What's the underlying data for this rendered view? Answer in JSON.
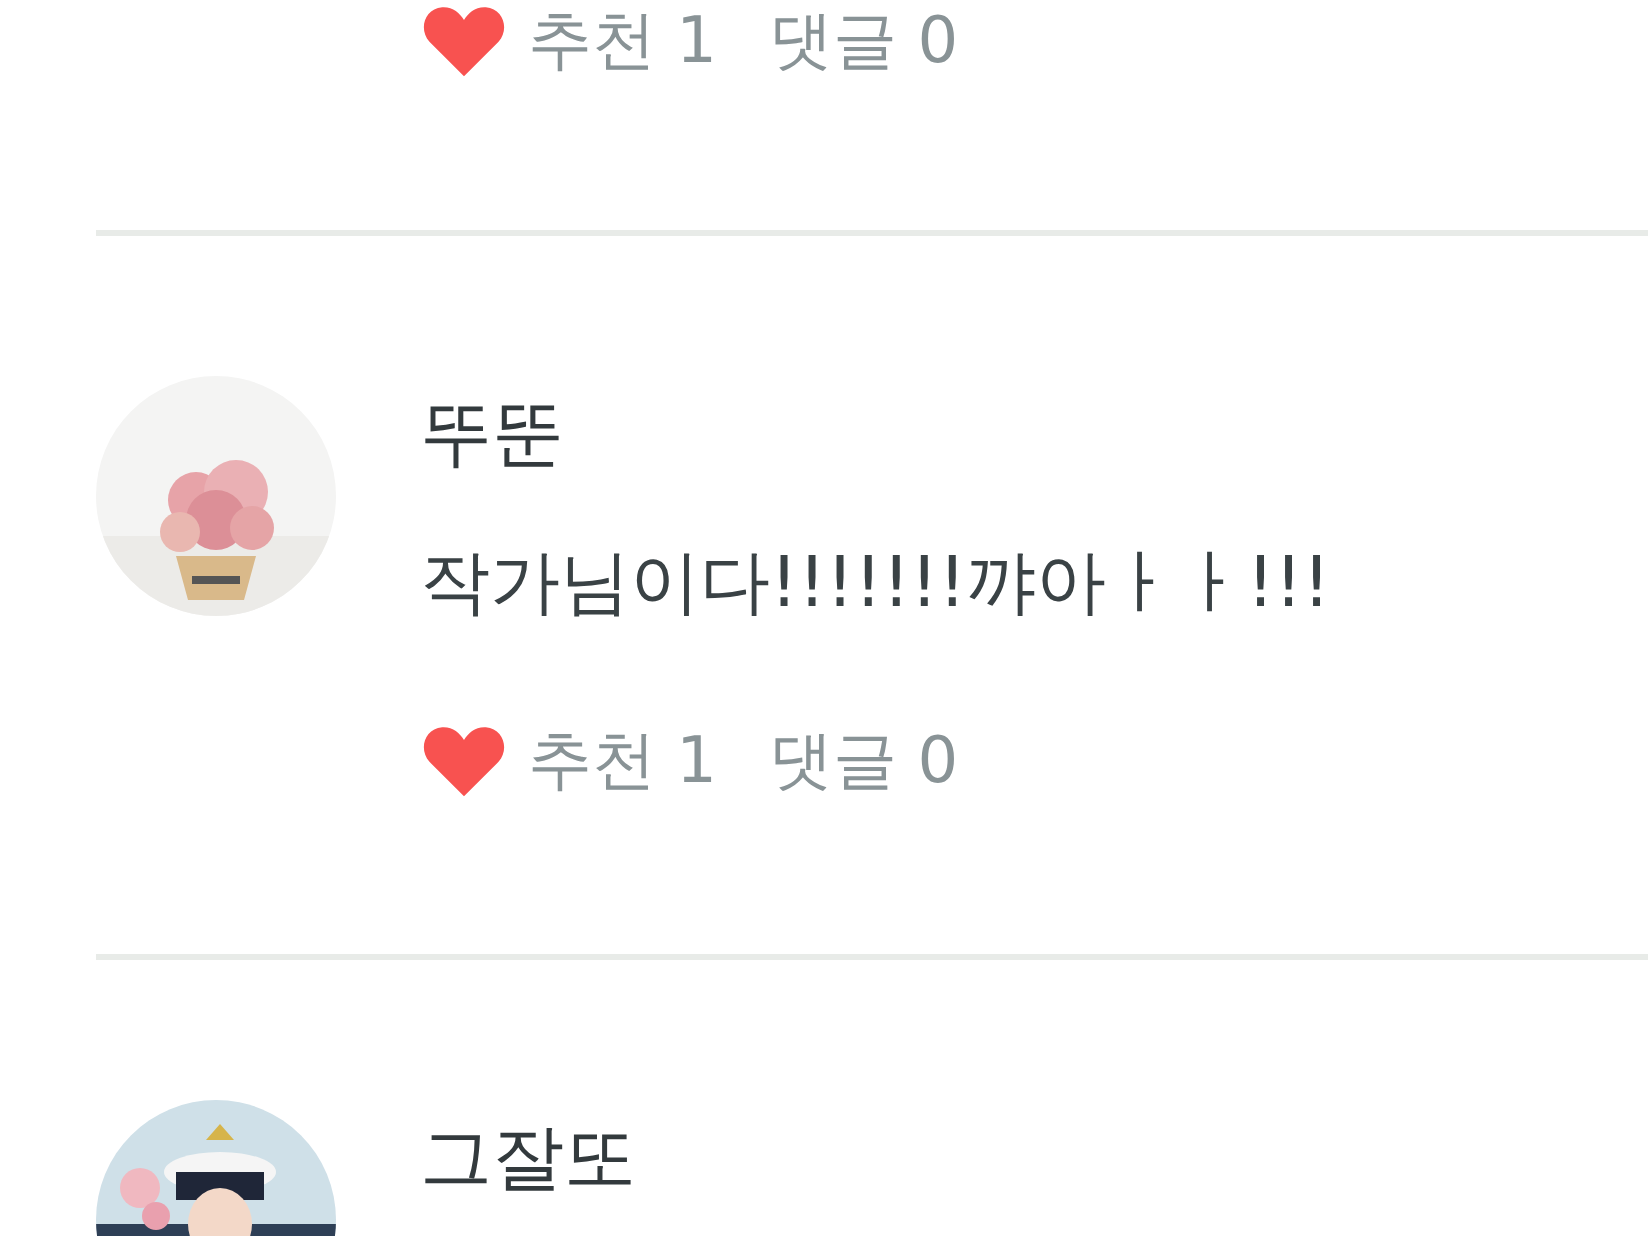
{
  "comments": [
    {
      "likes": "추천 1",
      "replies": "댓글 0"
    },
    {
      "author": "뚜뚠",
      "text": "작가님이다!!!!!!!꺄아ㅏㅏ!!!",
      "likes": "추천 1",
      "replies": "댓글 0"
    },
    {
      "author": "그잘또"
    }
  ]
}
